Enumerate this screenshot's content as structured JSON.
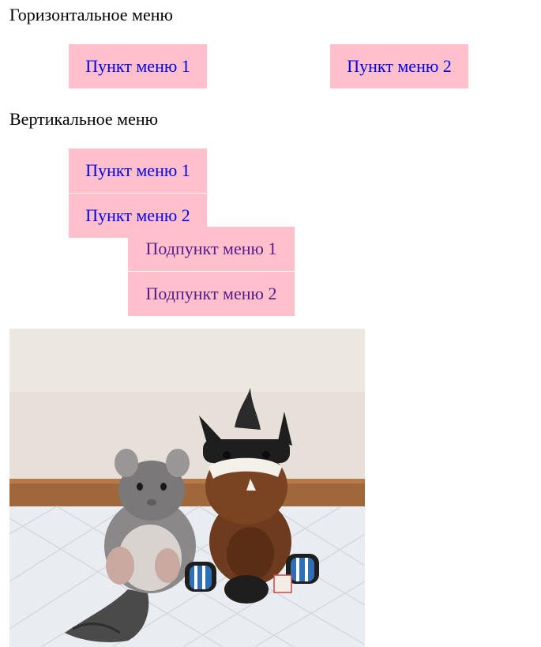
{
  "horizontal_menu": {
    "title": "Горизонтальное меню",
    "items": [
      {
        "label": "Пункт меню 1"
      },
      {
        "label": "Пункт меню 2"
      }
    ]
  },
  "vertical_menu": {
    "title": "Вертикальное меню",
    "items": [
      {
        "label": "Пункт меню 1"
      },
      {
        "label": "Пункт меню 2"
      }
    ],
    "submenu": [
      {
        "label": "Подпункт меню 1"
      },
      {
        "label": "Подпункт меню 2"
      }
    ]
  },
  "colors": {
    "menu_background": "#ffc0cb",
    "link": "#0000ee",
    "visited_link": "#551a8b"
  },
  "photo": {
    "subject": "chinchilla-and-horse-plush-toy"
  }
}
